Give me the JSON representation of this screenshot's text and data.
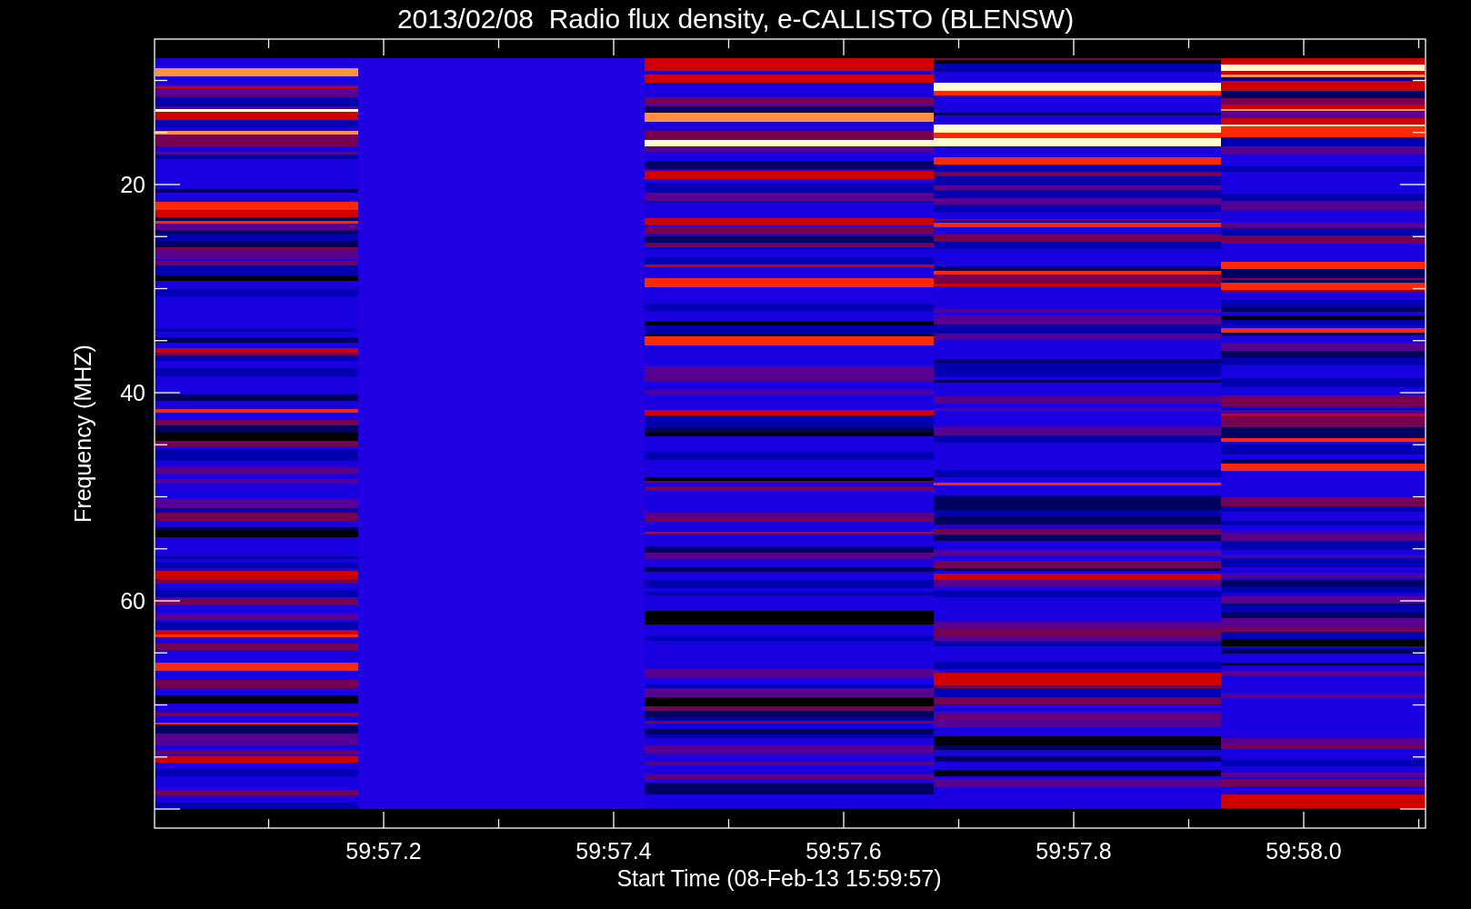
{
  "title": "2013/02/08  Radio flux density, e-CALLISTO (BLENSW)",
  "plot": {
    "ylabel": "Frequency (MHZ)",
    "xlabel": "Start Time (08-Feb-13 15:59:57)",
    "yticks": [
      "20",
      "40",
      "60"
    ],
    "xticks": [
      "59:57.2",
      "59:57.4",
      "59:57.6",
      "59:57.8",
      "59:58.0"
    ]
  }
}
